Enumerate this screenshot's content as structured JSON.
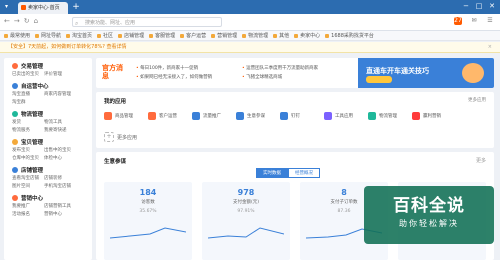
{
  "browser": {
    "tab_title": "卖家中心·首页",
    "tab_add": "+",
    "controls": [
      "−",
      "□",
      "✕"
    ],
    "nav": [
      "←",
      "→",
      "↻",
      "⌂"
    ],
    "search_placeholder": "搜索功能、网址、应用",
    "toolbar_right": [
      "27",
      "✉",
      "☰"
    ]
  },
  "bookmarks": [
    "最常使用",
    "网址导航",
    "淘宝首页",
    "社区",
    "店铺管理",
    "客服管理",
    "客户运营",
    "营销管理",
    "物流管理",
    "其他",
    "卖家中心",
    "1688采购找货平台"
  ],
  "notice": {
    "text": "【安全】7天前起，如何做到订单转化78%?  查看详情",
    "close": "×"
  },
  "sidebar": {
    "groups": [
      {
        "title": "交易管理",
        "color": "#ff6b3d",
        "links": [
          "已卖出的宝贝",
          "评价管理"
        ]
      },
      {
        "title": "自运营中心",
        "color": "#3a80d8",
        "links": [
          "淘宝直播",
          "商家内容管理",
          "淘宝群"
        ]
      },
      {
        "title": "物流管理",
        "color": "#1fb89a",
        "links": [
          "发货",
          "物流工具",
          "物流服务",
          "我要寄快递"
        ]
      },
      {
        "title": "宝贝管理",
        "color": "#f3a93b",
        "links": [
          "发布宝贝",
          "出售中的宝贝",
          "仓库中的宝贝",
          "体检中心"
        ]
      },
      {
        "title": "店铺管理",
        "color": "#3a80d8",
        "links": [
          "查看淘宝店铺",
          "店铺装修",
          "图片空间",
          "手机淘宝店铺"
        ]
      },
      {
        "title": "营销中心",
        "color": "#ff6b3d",
        "links": [
          "我要推广",
          "店铺营销工具",
          "活动报名",
          "营销中心"
        ]
      }
    ]
  },
  "promo": {
    "logo": "官方消息",
    "news": [
      "每日100件，新商家十一促销",
      "运营团队三季度用千万流量助新商家",
      "如果网已经无法接入了，如何做营销",
      "飞猪全球精选商城"
    ],
    "banner_title": "直通车开车通关技巧"
  },
  "apps": {
    "title": "我的应用",
    "more": "更多应用",
    "items": [
      {
        "label": "商品管理",
        "color": "#ff6b3d"
      },
      {
        "label": "客户运营",
        "color": "#ff6b3d"
      },
      {
        "label": "流量推广",
        "color": "#3a80d8"
      },
      {
        "label": "生意参谋",
        "color": "#3a80d8"
      },
      {
        "label": "钉钉",
        "color": "#3a80d8"
      },
      {
        "label": "工具应用",
        "color": "#7b61ff"
      },
      {
        "label": "物流管理",
        "color": "#1fb89a"
      },
      {
        "label": "赢利营销",
        "color": "#ff3b3b"
      }
    ],
    "add_label": "更多应用"
  },
  "business": {
    "title": "生意参谋",
    "more": "更多",
    "tabs": [
      "实时数据",
      "经营概况"
    ],
    "active_tab": 0,
    "cards": [
      {
        "value": "184",
        "label": "访客数",
        "compare": "35.67%"
      },
      {
        "value": "978",
        "label": "支付金额(元)",
        "compare": "97.91%"
      },
      {
        "value": "8",
        "label": "支付子订单数",
        "compare": "87.36"
      },
      {
        "value": "",
        "label": "",
        "compare": ""
      }
    ]
  },
  "watermark": {
    "line1": "百科全说",
    "line2": "助你轻松解决"
  }
}
